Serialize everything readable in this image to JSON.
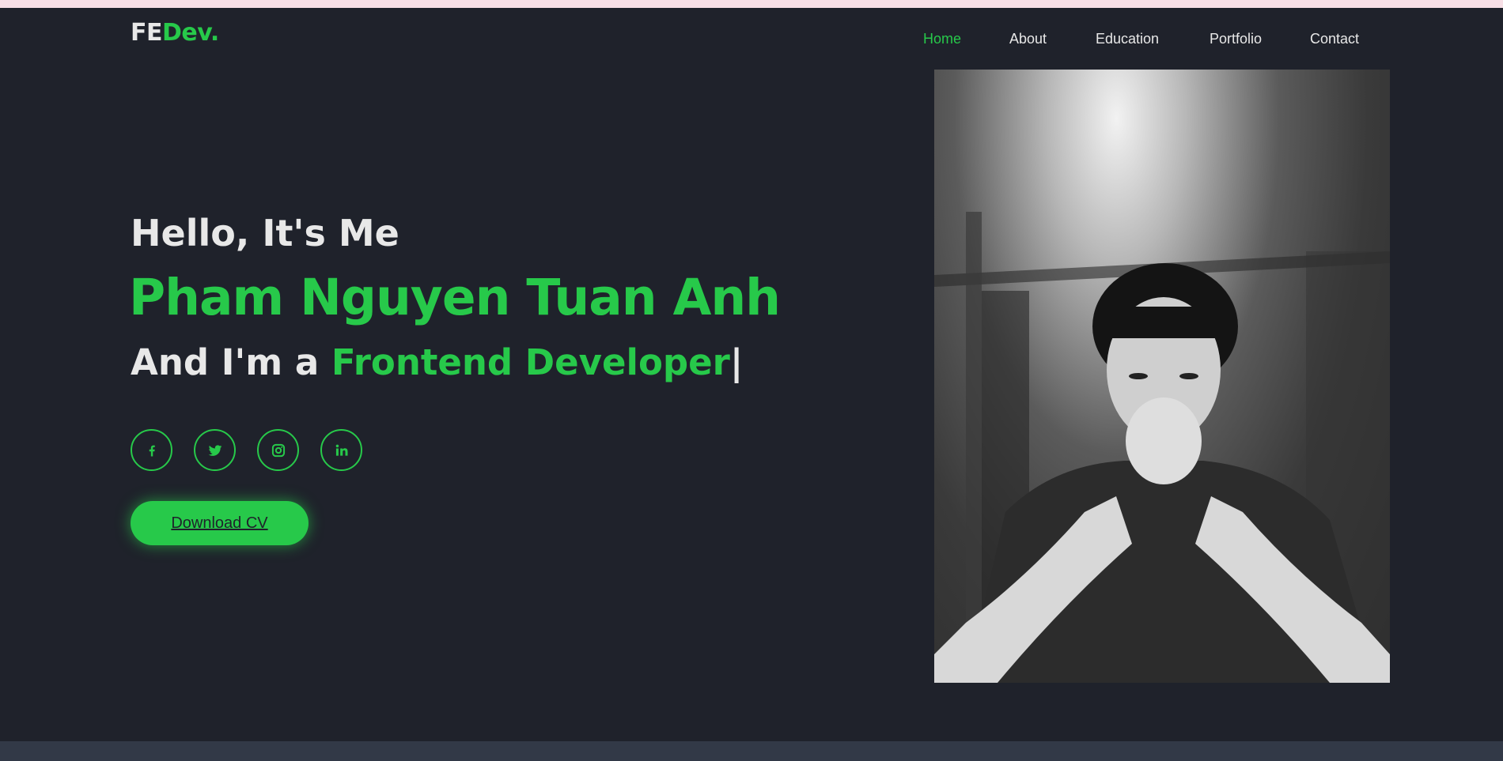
{
  "header": {
    "logo_part1": "FE",
    "logo_part2": "Dev."
  },
  "nav": {
    "items": [
      {
        "label": "Home",
        "active": true
      },
      {
        "label": "About",
        "active": false
      },
      {
        "label": "Education",
        "active": false
      },
      {
        "label": "Portfolio",
        "active": false
      },
      {
        "label": "Contact",
        "active": false
      }
    ]
  },
  "hero": {
    "greeting": "Hello, It's Me",
    "name": "Pham Nguyen Tuan Anh",
    "role_prefix": "And I'm a ",
    "role_highlight": "Frontend Developer",
    "cursor": "|",
    "download_label": "Download CV"
  },
  "socials": [
    {
      "icon": "facebook-icon"
    },
    {
      "icon": "twitter-icon"
    },
    {
      "icon": "instagram-icon"
    },
    {
      "icon": "linkedin-icon"
    }
  ],
  "colors": {
    "background": "#1f222b",
    "accent": "#27c94a",
    "text": "#e8e8e8",
    "bottom_band": "#323947"
  }
}
